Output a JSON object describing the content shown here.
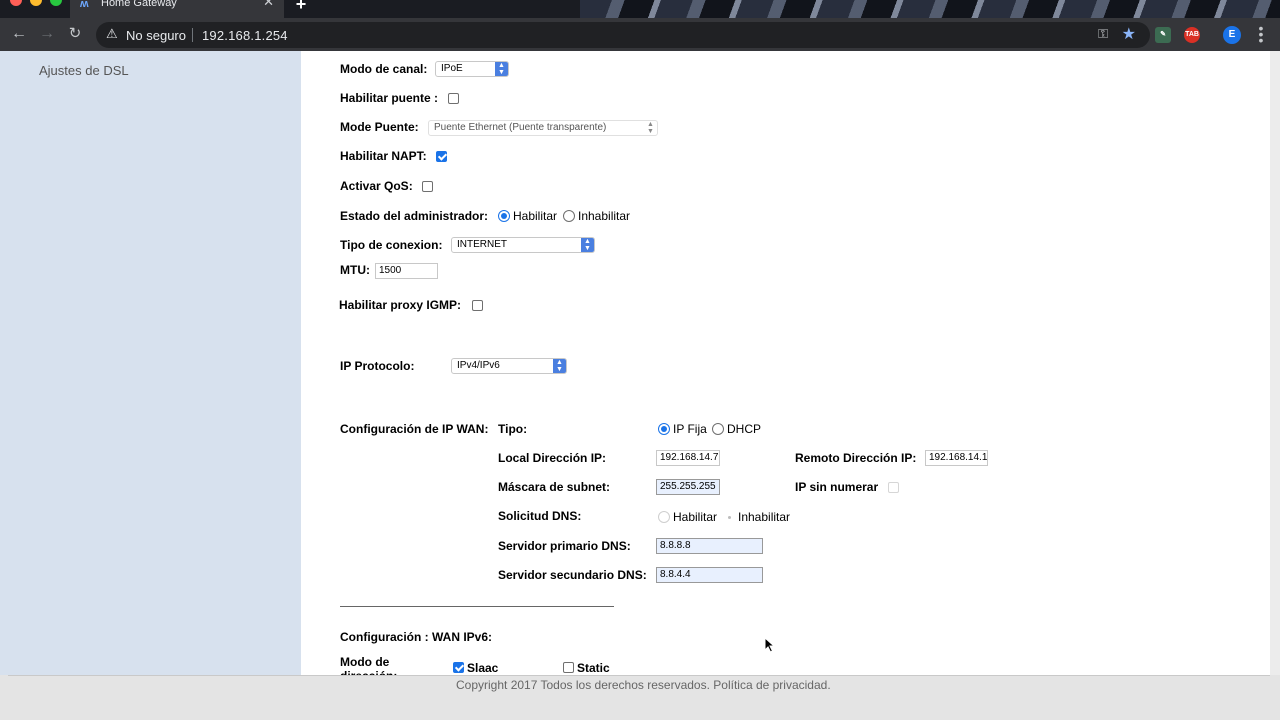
{
  "browser": {
    "tab_title": "Home Gateway",
    "tab_close": "✕",
    "new_tab": "+",
    "security_label": "No seguro",
    "url": "192.168.1.254",
    "ext_tab": "TAB",
    "profile_initial": "E"
  },
  "sidebar": {
    "items": [
      {
        "label": "Ajustes de DSL"
      }
    ]
  },
  "form": {
    "modo_canal": {
      "label": "Modo de canal:",
      "value": "IPoE"
    },
    "habilitar_puente": {
      "label": "Habilitar puente :",
      "checked": false
    },
    "mode_puente": {
      "label": "Mode Puente:",
      "value": "Puente Ethernet (Puente transparente)"
    },
    "habilitar_napt": {
      "label": "Habilitar NAPT:",
      "checked": true
    },
    "activar_qos": {
      "label": "Activar QoS:",
      "checked": false
    },
    "estado_admin": {
      "label": "Estado del administrador:",
      "opt1": "Habilitar",
      "opt2": "Inhabilitar",
      "selected": "Habilitar"
    },
    "tipo_conexion": {
      "label": "Tipo de conexion:",
      "value": "INTERNET"
    },
    "mtu": {
      "label": "MTU:",
      "value": "1500"
    },
    "proxy_igmp": {
      "label": "Habilitar proxy IGMP:",
      "checked": false
    },
    "ip_protocolo": {
      "label": "IP Protocolo:",
      "value": "IPv4/IPv6"
    },
    "wan_ip": {
      "label": "Configuración de IP WAN:",
      "tipo_label": "Tipo:",
      "opt1": "IP Fija",
      "opt2": "DHCP",
      "selected": "IP Fija",
      "local_ip_label": "Local Dirección IP:",
      "local_ip": "192.168.14.7",
      "remote_ip_label": "Remoto Dirección IP:",
      "remote_ip": "192.168.14.1",
      "mask_label": "Máscara de subnet:",
      "mask": "255.255.255",
      "ip_unnumbered_label": "IP sin numerar",
      "dns_label": "Solicitud DNS:",
      "dns_opt1": "Habilitar",
      "dns_opt2": "Inhabilitar",
      "dns_primary_label": "Servidor primario DNS:",
      "dns_primary": "8.8.8.8",
      "dns_secondary_label": "Servidor secundario DNS:",
      "dns_secondary": "8.8.4.4"
    },
    "ipv6": {
      "label": "Configuración : WAN IPv6:",
      "mode_label": "Modo de dirección:",
      "slaac": "Slaac",
      "static": "Static"
    }
  },
  "footer": "Copyright 2017 Todos los derechos reservados. Política de privacidad."
}
